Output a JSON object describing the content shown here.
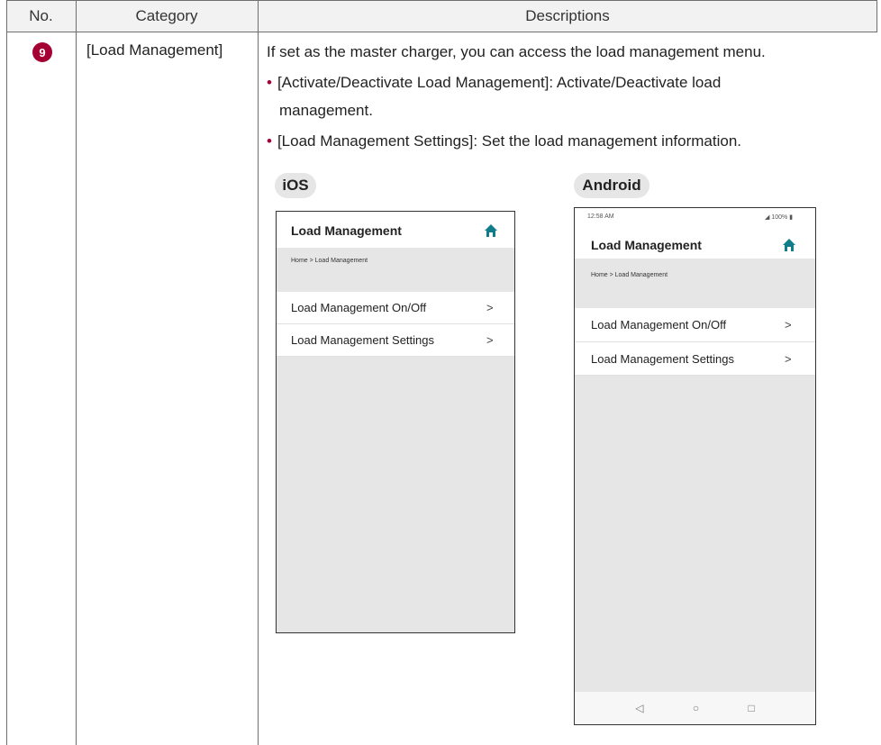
{
  "header": {
    "col_no": "No.",
    "col_category": "Category",
    "col_descriptions": "Descriptions"
  },
  "row": {
    "number": "9",
    "category": "[Load Management]",
    "intro": "If set as the master charger, you can access the load management menu.",
    "bullets": [
      {
        "line1": "[Activate/Deactivate Load Management]: Activate/Deactivate load",
        "line2": "management."
      },
      {
        "line1": "[Load Management Settings]: Set the load management information."
      }
    ]
  },
  "ios": {
    "tag": "iOS",
    "title": "Load Management",
    "breadcrumb": "Home > Load Management",
    "items": [
      "Load Management On/Off",
      "Load Management Settings"
    ],
    "chevron": ">",
    "icon": "home-icon"
  },
  "android": {
    "tag": "Android",
    "time": "12:58 AM",
    "battery": "100%",
    "title": "Load Management",
    "breadcrumb": "Home > Load Management",
    "items": [
      "Load Management On/Off",
      "Load Management Settings"
    ],
    "chevron": ">",
    "nav": {
      "back": "◁",
      "home": "○",
      "recent": "□"
    }
  },
  "colors": {
    "accent": "#a50034",
    "home_icon": "#0f7d8a",
    "header_bg": "#f2f2f2"
  }
}
